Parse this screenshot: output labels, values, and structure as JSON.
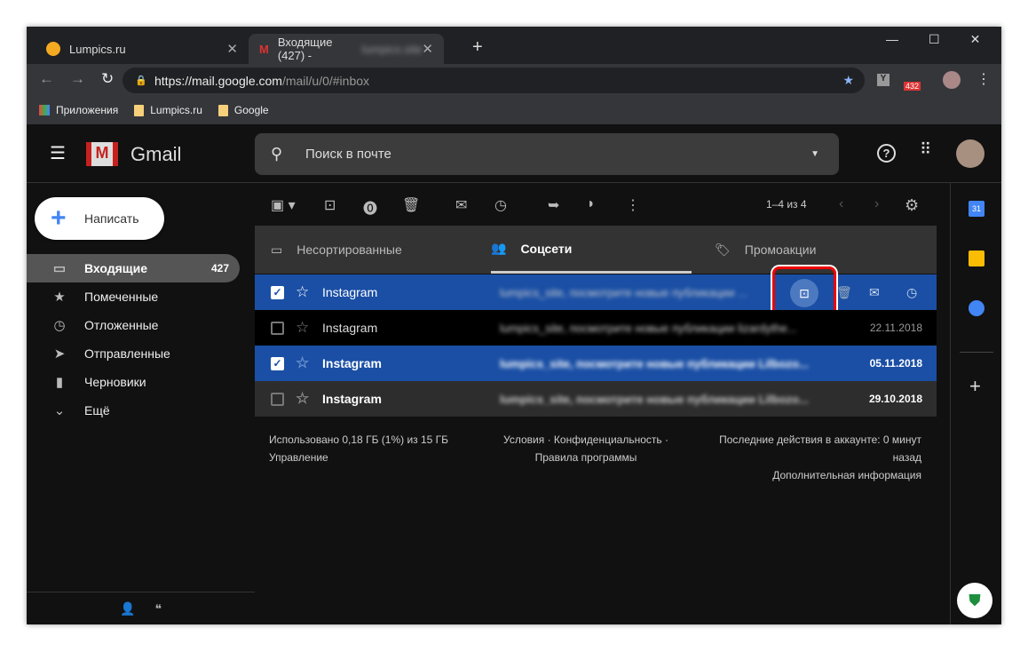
{
  "browser": {
    "tabs": [
      {
        "title": "Lumpics.ru"
      },
      {
        "title": "Входящие (427) -"
      }
    ],
    "url_host": "https://mail.google.com",
    "url_path": "/mail/u/0/#inbox",
    "ext_badge": "432",
    "bookmarks": [
      "Приложения",
      "Lumpics.ru",
      "Google"
    ]
  },
  "gmail": {
    "logo": "Gmail",
    "search_placeholder": "Поиск в почте",
    "compose": "Написать",
    "nav": [
      {
        "label": "Входящие",
        "count": "427"
      },
      {
        "label": "Помеченные"
      },
      {
        "label": "Отложенные"
      },
      {
        "label": "Отправленные"
      },
      {
        "label": "Черновики"
      },
      {
        "label": "Ещё"
      }
    ],
    "pagination": "1–4 из 4",
    "categories": [
      "Несортированные",
      "Соцсети",
      "Промоакции"
    ],
    "emails": [
      {
        "from": "Instagram",
        "snippet": "lumpics_site, посмотрите новые публикации ...",
        "date": "",
        "checked": true
      },
      {
        "from": "Instagram",
        "snippet": "lumpics_site, посмотрите новые публикации lizardythe...",
        "date": "22.11.2018",
        "checked": false
      },
      {
        "from": "Instagram",
        "snippet": "lumpics_site, посмотрите новые публикации Lilbozo...",
        "date": "05.11.2018",
        "checked": true
      },
      {
        "from": "Instagram",
        "snippet": "lumpics_site, посмотрите новые публикации Lilbozo...",
        "date": "29.10.2018",
        "checked": false
      }
    ],
    "footer": {
      "storage": "Использовано 0,18 ГБ (1%) из 15 ГБ",
      "manage": "Управление",
      "terms": "Условия · Конфиденциальность ·",
      "program": "Правила программы",
      "activity": "Последние действия в аккаунте: 0 минут",
      "activity2": "назад",
      "details": "Дополнительная информация"
    }
  }
}
